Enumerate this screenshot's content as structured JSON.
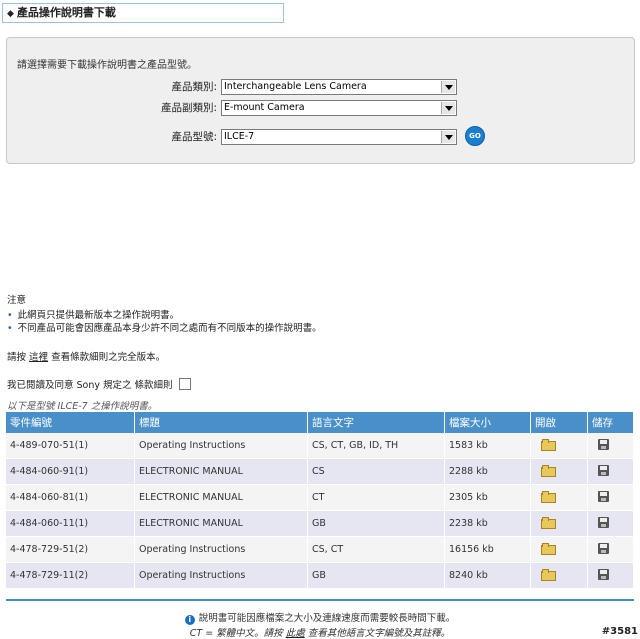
{
  "header": {
    "title": "產品操作說明書下載",
    "marker": "◆"
  },
  "selector": {
    "instruction": "請選擇需要下載操作說明書之產品型號。",
    "category_label": "產品類別:",
    "category_value": "Interchangeable Lens Camera",
    "subcategory_label": "產品副類別:",
    "subcategory_value": "E-mount Camera",
    "model_label": "產品型號:",
    "model_value": "ILCE-7",
    "go_label": "GO"
  },
  "notes": {
    "title": "注意",
    "items": [
      "此網頁只提供最新版本之操作說明書。",
      "不同產品可能會因應產品本身少許不同之處而有不同版本的操作說明書。"
    ],
    "terms_prefix": "請按",
    "terms_link": "這裡",
    "terms_suffix": "查看條款細則之完全版本。",
    "agree_text": "我已閱讀及同意 Sony 規定之 條款細則"
  },
  "model_caption": "以下是型號 ILCE-7 之操作說明書。",
  "table": {
    "headers": [
      "零件編號",
      "標題",
      "語言文字",
      "檔案大小",
      "開啟",
      "儲存"
    ],
    "rows": [
      {
        "part": "4-489-070-51(1)",
        "title": "Operating Instructions",
        "lang": "CS, CT, GB, ID, TH",
        "size": "1583 kb"
      },
      {
        "part": "4-484-060-91(1)",
        "title": "ELECTRONIC MANUAL",
        "lang": "CS",
        "size": "2288 kb"
      },
      {
        "part": "4-484-060-81(1)",
        "title": "ELECTRONIC MANUAL",
        "lang": "CT",
        "size": "2305 kb"
      },
      {
        "part": "4-484-060-11(1)",
        "title": "ELECTRONIC MANUAL",
        "lang": "GB",
        "size": "2238 kb"
      },
      {
        "part": "4-478-729-51(2)",
        "title": "Operating Instructions",
        "lang": "CS, CT",
        "size": "16156 kb"
      },
      {
        "part": "4-478-729-11(2)",
        "title": "Operating Instructions",
        "lang": "GB",
        "size": "8240 kb"
      }
    ]
  },
  "footer": {
    "line1": "說明書可能因應檔案之大小及連線速度而需要較長時間下載。",
    "line2_prefix": "CT = 繁體中文。請按",
    "line2_link": "此處",
    "line2_suffix": "查看其他語言文字編號及其註釋。"
  },
  "watermark": "#3581"
}
